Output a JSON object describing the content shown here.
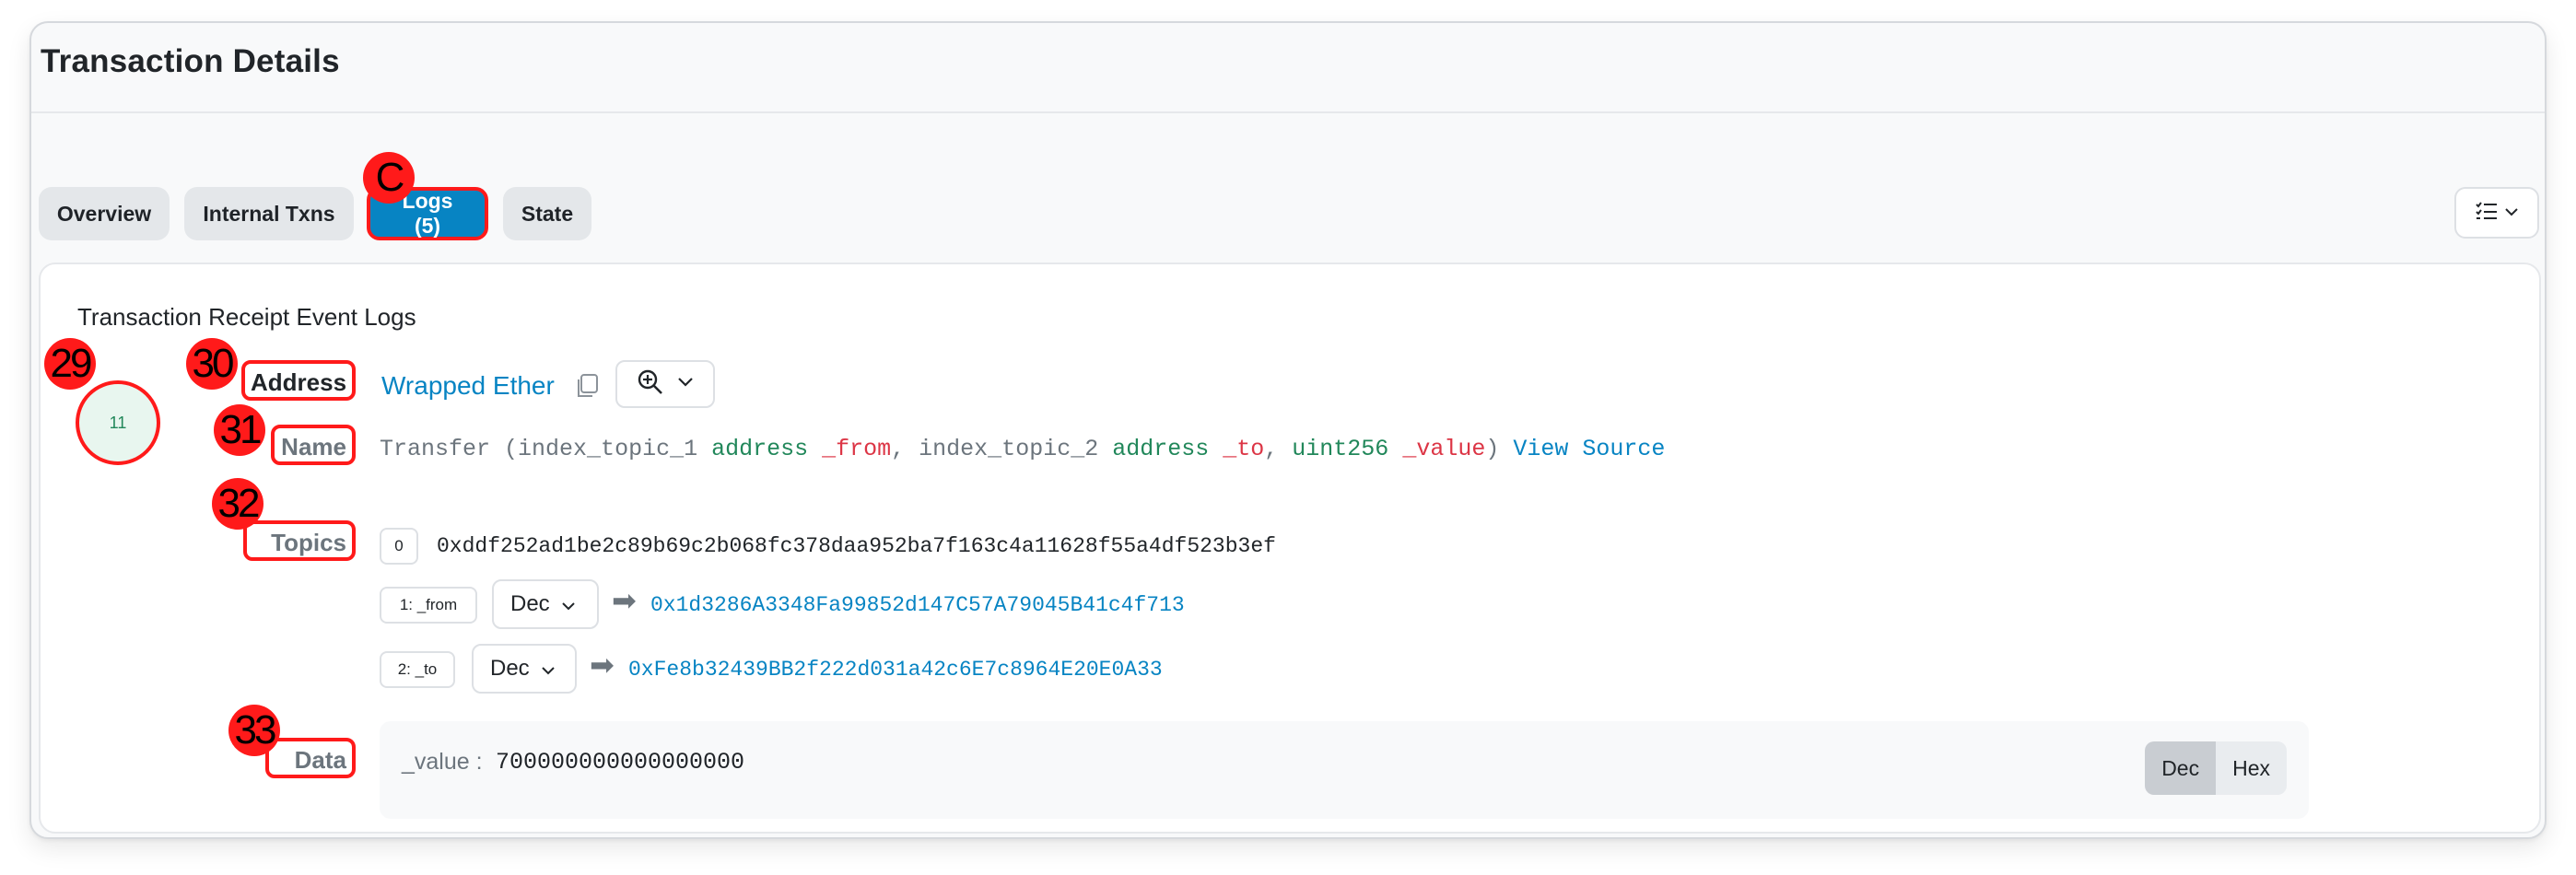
{
  "page": {
    "title": "Transaction Details"
  },
  "tabs": [
    {
      "label": "Overview",
      "active": false
    },
    {
      "label": "Internal Txns",
      "active": false
    },
    {
      "label": "Logs (5)",
      "active": true
    },
    {
      "label": "State",
      "active": false
    }
  ],
  "view_toggle": {
    "icon": "list-check-icon",
    "chevron": "chevron-down-icon"
  },
  "logs": {
    "heading": "Transaction Receipt Event Logs",
    "log_index": "11",
    "address": {
      "label": "Address",
      "value": "Wrapped Ether",
      "copy_icon": "copy-icon",
      "zoom_icon": "zoom-in-icon"
    },
    "name": {
      "label": "Name",
      "fn": "Transfer",
      "open": " (",
      "p1_prefix": "index_topic_1 ",
      "p1_type": "address",
      "p1_name": "_from",
      "sep1": ", ",
      "p2_prefix": "index_topic_2 ",
      "p2_type": "address",
      "p2_name": "_to",
      "sep2": ", ",
      "p3_type": "uint256",
      "p3_name": "_value",
      "close": ")",
      "view_source": "View Source"
    },
    "topics": {
      "label": "Topics",
      "items": [
        {
          "index": "0",
          "value": "0xddf252ad1be2c89b69c2b068fc378daa952ba7f163c4a11628f55a4df523b3ef"
        },
        {
          "index": "1: _from",
          "format": "Dec",
          "value": "0x1d3286A3348Fa99852d147C57A79045B41c4f713"
        },
        {
          "index": "2: _to",
          "format": "Dec",
          "value": "0xFe8b32439BB2f222d031a42c6E7c8964E20E0A33"
        }
      ]
    },
    "data": {
      "label": "Data",
      "key": "_value :",
      "value": "700000000000000000",
      "formats": [
        "Dec",
        "Hex"
      ],
      "selected_format": "Dec"
    }
  },
  "markers": {
    "tab": "C",
    "log": "29",
    "address": "30",
    "name": "31",
    "topics": "32",
    "data": "33"
  },
  "colors": {
    "accent": "#0784c3",
    "marker": "#ff1a1a",
    "keyword": "#21875a",
    "param": "#dc3545"
  }
}
